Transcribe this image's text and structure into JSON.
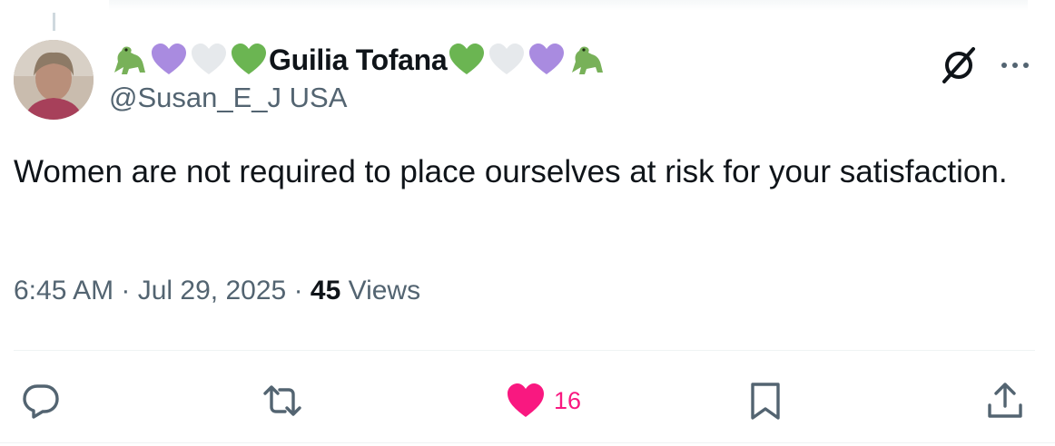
{
  "author": {
    "display_name": "Guilia Tofana",
    "handle": "@Susan_E_J USA",
    "name_emojis_before": [
      "dinosaur-icon",
      "purple-heart-icon",
      "white-heart-icon",
      "green-heart-icon"
    ],
    "name_emojis_after": [
      "green-heart-icon",
      "white-heart-icon",
      "purple-heart-icon",
      "dinosaur-icon"
    ]
  },
  "tweet": {
    "text": "Women are not required to place ourselves at risk for your satisfaction.",
    "time": "6:45 AM",
    "date": "Jul 29, 2025",
    "views_count": "45",
    "views_label": "Views"
  },
  "actions": {
    "like_count": "16"
  },
  "colors": {
    "text": "#0f1419",
    "secondary": "#536471",
    "like": "#f91880",
    "purple_heart": "#a98be0",
    "green_heart": "#6bb552",
    "white_heart": "#e6e9ec",
    "dinosaur": "#78b159"
  }
}
